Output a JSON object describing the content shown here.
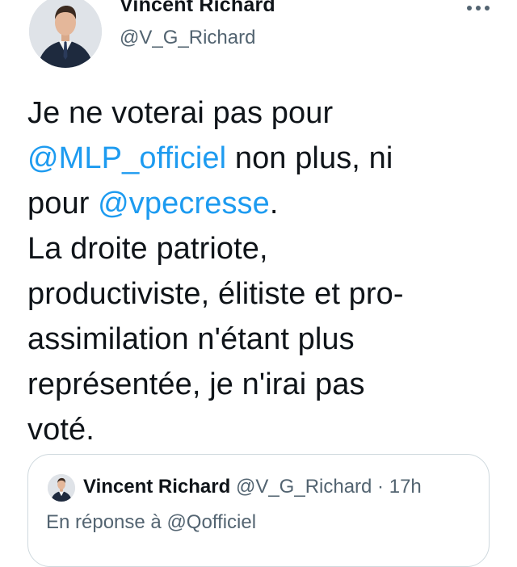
{
  "author": {
    "display_name": "Vincent Richard",
    "handle": "@V_G_Richard"
  },
  "tweet": {
    "lines": [
      [
        {
          "text": "Je ne voterai pas pour",
          "mention": false
        }
      ],
      [
        {
          "text": "@MLP_officiel",
          "mention": true
        },
        {
          "text": " non plus, ni",
          "mention": false
        }
      ],
      [
        {
          "text": "pour ",
          "mention": false
        },
        {
          "text": "@vpecresse",
          "mention": true
        },
        {
          "text": ".",
          "mention": false
        }
      ],
      [
        {
          "text": "La droite patriote,",
          "mention": false
        }
      ],
      [
        {
          "text": "productiviste, élitiste et pro-",
          "mention": false
        }
      ],
      [
        {
          "text": "assimilation n'étant plus",
          "mention": false
        }
      ],
      [
        {
          "text": "représentée, je n'irai pas",
          "mention": false
        }
      ],
      [
        {
          "text": "voté.",
          "mention": false
        }
      ]
    ]
  },
  "quoted_tweet": {
    "display_name": "Vincent Richard",
    "handle": "@V_G_Richard",
    "separator": " · ",
    "time": "17h",
    "reply_to_prefix": "En réponse à ",
    "reply_to_handle": "@Qofficiel"
  },
  "icons": {
    "more": "more-horizontal-icon",
    "avatar": "avatar"
  },
  "colors": {
    "mention": "#1d9bf0",
    "secondary_text": "#536471",
    "border": "#cfd9de"
  }
}
